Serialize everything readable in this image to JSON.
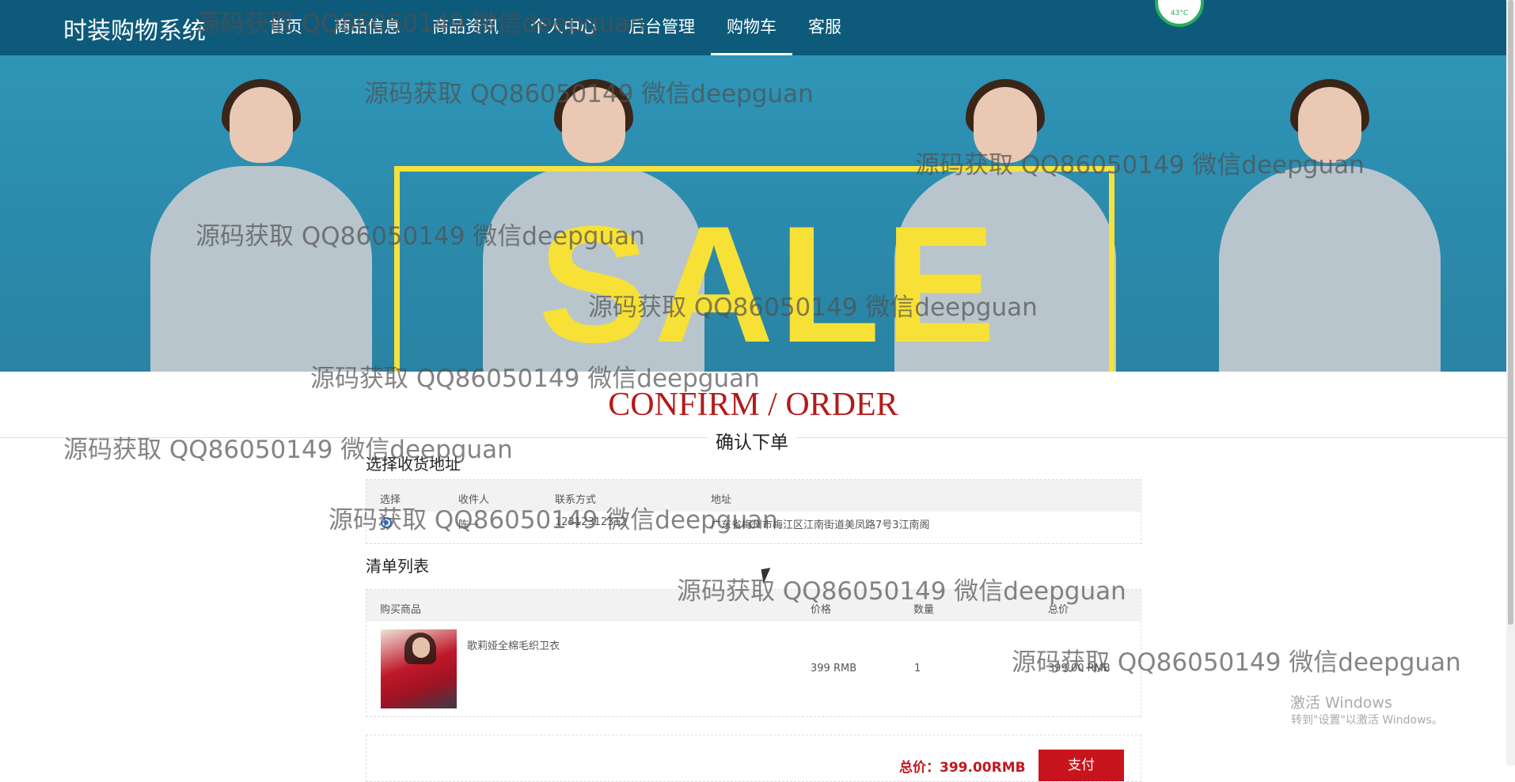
{
  "header": {
    "brand": "时装购物系统",
    "nav": [
      "首页",
      "商品信息",
      "商品资讯",
      "个人中心",
      "后台管理",
      "购物车",
      "客服"
    ],
    "active_nav": "购物车",
    "widget_temp": "43°C"
  },
  "banner": {
    "text": "SALE"
  },
  "page": {
    "title": "CONFIRM / ORDER",
    "subtitle": "确认下单"
  },
  "address": {
    "label": "选择收货地址",
    "headers": [
      "选择",
      "收件人",
      "联系方式",
      "地址"
    ],
    "rows": [
      {
        "selected": true,
        "recipient": "陈一",
        "phone": "12312312312",
        "address": "广东省梅州市梅江区江南街道美凤路7号3江南阁"
      }
    ]
  },
  "order": {
    "label": "清单列表",
    "headers": [
      "购买商品",
      "价格",
      "数量",
      "总价"
    ],
    "items": [
      {
        "name": "歌莉娅全棉毛织卫衣",
        "price": "399 RMB",
        "quantity": "1",
        "total": "399.00 RMB"
      }
    ]
  },
  "summary": {
    "total": "总价：399.00RMB",
    "pay_label": "支付"
  },
  "watermark": "源码获取 QQ86050149 微信deepguan",
  "windows": {
    "line1": "激活 Windows",
    "line2": "转到\"设置\"以激活 Windows。"
  },
  "colors": {
    "nav_bg": "#0e5a7a",
    "accent_red": "#c8141c",
    "title_red": "#b31b1b",
    "sale_yellow": "#f7e136"
  }
}
